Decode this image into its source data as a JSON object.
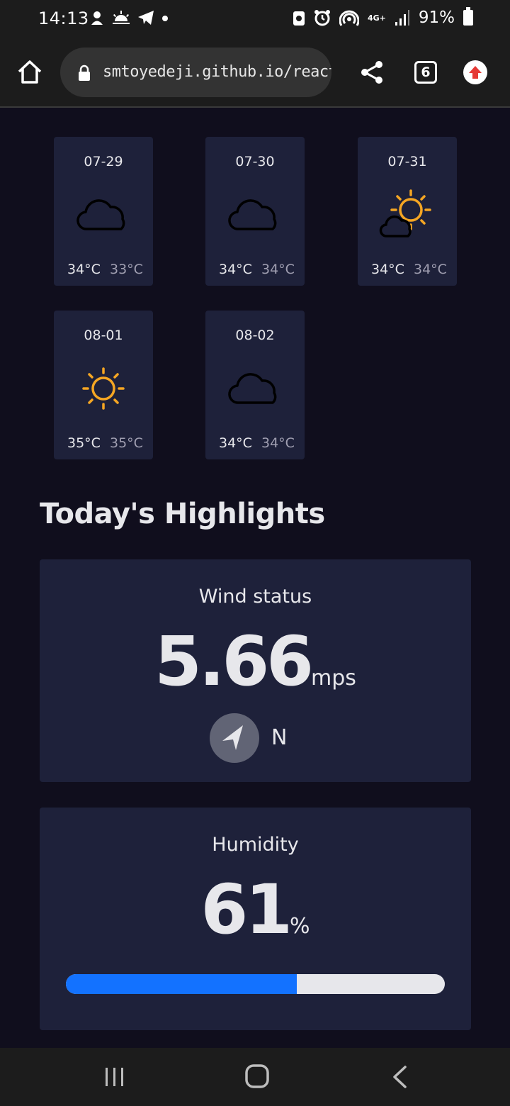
{
  "status_bar": {
    "time": "14:13",
    "network": "4G+",
    "battery": "91%"
  },
  "browser": {
    "url": "smtoyedeji.github.io/react-wea",
    "tab_count": "6"
  },
  "forecast": [
    {
      "date": "07-29",
      "icon": "cloud-icon",
      "max": "34°C",
      "min": "33°C"
    },
    {
      "date": "07-30",
      "icon": "cloud-icon",
      "max": "34°C",
      "min": "34°C"
    },
    {
      "date": "07-31",
      "icon": "sun-behind-cloud-icon",
      "max": "34°C",
      "min": "34°C"
    },
    {
      "date": "08-01",
      "icon": "sun-icon",
      "max": "35°C",
      "min": "35°C"
    },
    {
      "date": "08-02",
      "icon": "cloud-icon",
      "max": "34°C",
      "min": "34°C"
    }
  ],
  "highlights": {
    "title": "Today's Highlights",
    "wind": {
      "label": "Wind status",
      "value": "5.66",
      "unit": "mps",
      "direction": "N"
    },
    "humidity": {
      "label": "Humidity",
      "value": "61",
      "unit": "%",
      "percent": 61
    }
  },
  "colors": {
    "background": "#100e1d",
    "card": "#1e213a",
    "text": "#e7e7eb",
    "muted": "#a09fb1",
    "progress": "#1372ff",
    "sun": "#f5a623"
  }
}
